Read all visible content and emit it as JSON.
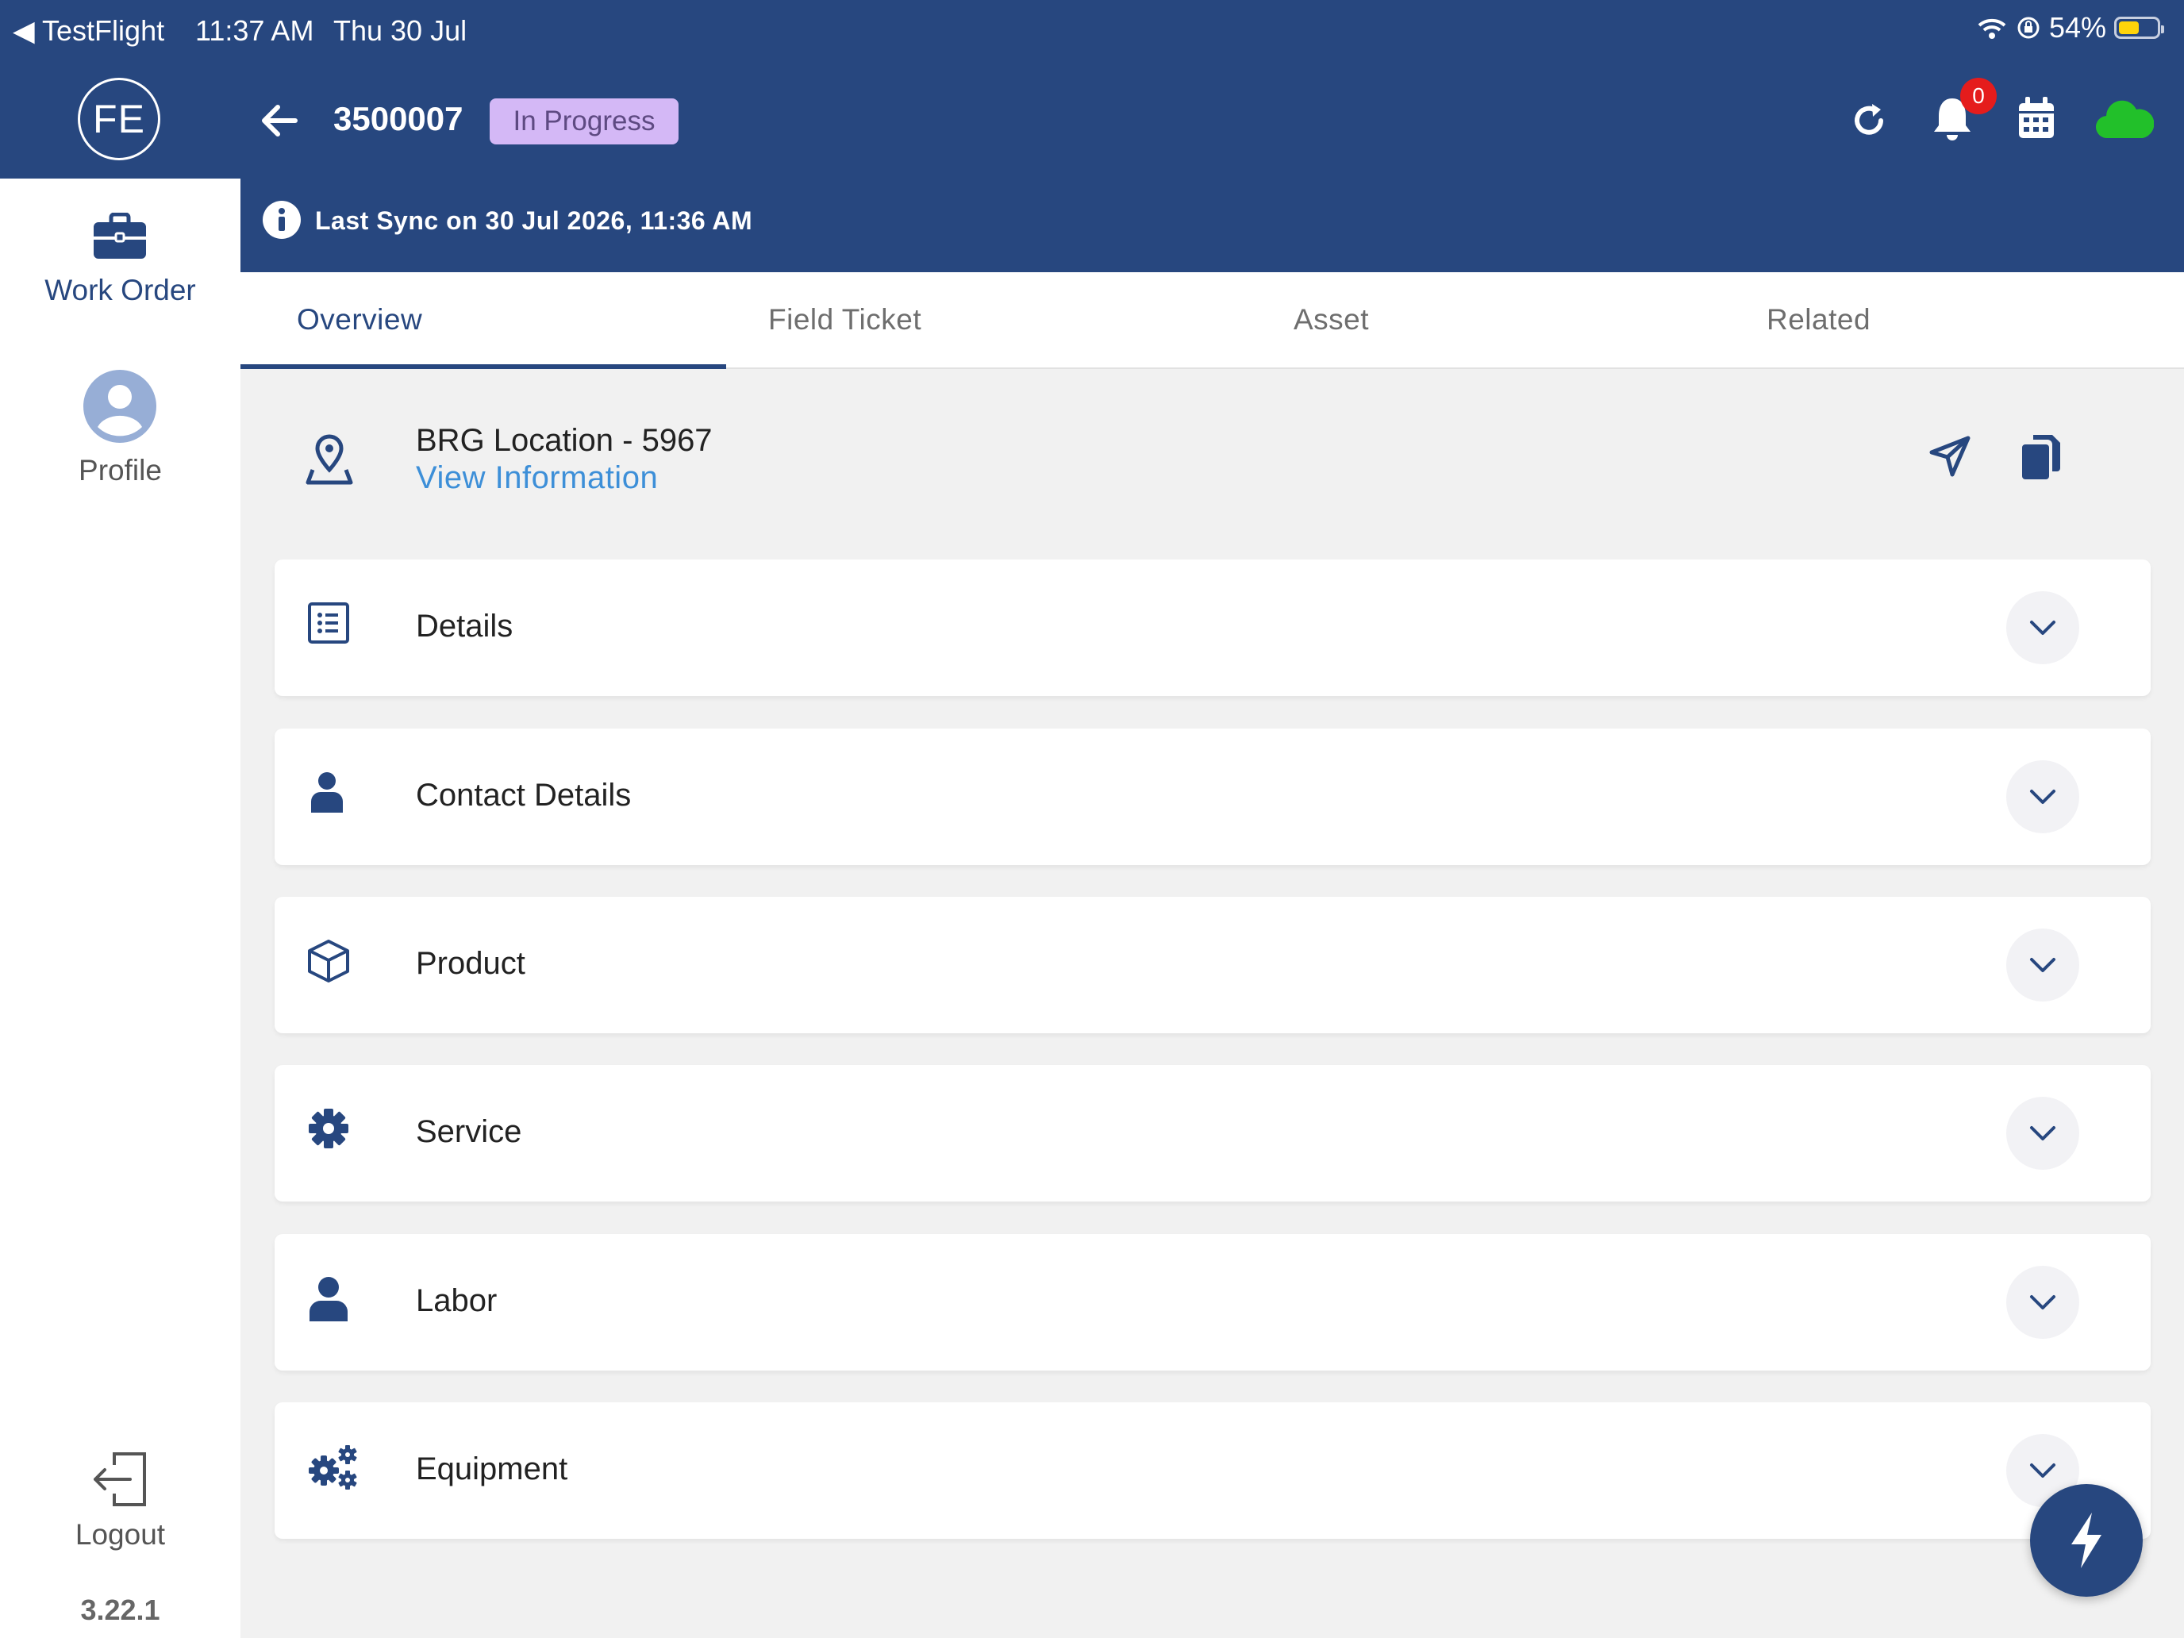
{
  "status_bar": {
    "back_app": "◀ TestFlight",
    "time": "11:37 AM",
    "date": "Thu 30 Jul",
    "battery_percent": "54%",
    "battery_level": 0.54
  },
  "app": {
    "logo_text": "FE",
    "work_order_number": "3500007",
    "status_badge": "In Progress",
    "notification_count": "0",
    "last_sync": "Last Sync on 30 Jul 2026, 11:36 AM",
    "colors": {
      "primary": "#27477f",
      "badge": "#d4b8f6",
      "link": "#3d8fd8",
      "cloud": "#22c02a",
      "notif": "#e51c1c"
    }
  },
  "sidebar": {
    "items": [
      {
        "label": "Work Order",
        "icon": "briefcase-icon",
        "active": true
      },
      {
        "label": "Profile",
        "icon": "user-circle-icon",
        "active": false
      }
    ],
    "logout_label": "Logout",
    "version": "3.22.1"
  },
  "tabs": [
    {
      "label": "Overview",
      "active": true
    },
    {
      "label": "Field Ticket",
      "active": false
    },
    {
      "label": "Asset",
      "active": false
    },
    {
      "label": "Related",
      "active": false
    }
  ],
  "location": {
    "title": "BRG Location - 5967",
    "link": "View Information"
  },
  "sections": [
    {
      "label": "Details",
      "icon": "list-icon"
    },
    {
      "label": "Contact Details",
      "icon": "person-icon"
    },
    {
      "label": "Product",
      "icon": "cube-icon"
    },
    {
      "label": "Service",
      "icon": "gear-icon"
    },
    {
      "label": "Labor",
      "icon": "worker-icon"
    },
    {
      "label": "Equipment",
      "icon": "gears-icon"
    }
  ]
}
